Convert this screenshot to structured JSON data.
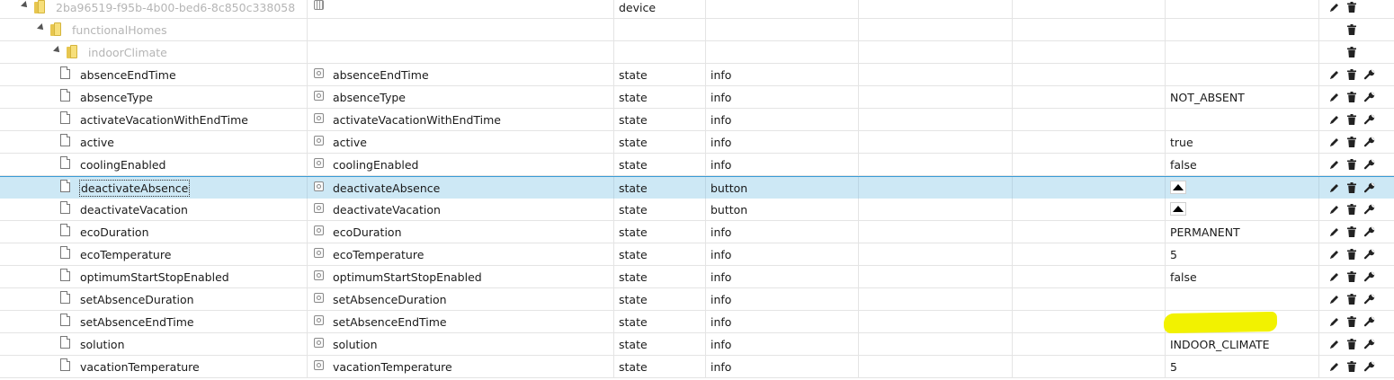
{
  "rows": [
    {
      "name": "2ba96519-f95b-4b00-bed6-8c850c338058",
      "level": 0,
      "kind": "folder",
      "faded": true,
      "expanded": true,
      "role_icon": "grid-icon",
      "role": "",
      "type": "device",
      "subrole": "",
      "value": "",
      "actions": [
        "edit",
        "delete"
      ]
    },
    {
      "name": "functionalHomes",
      "level": 1,
      "kind": "folder",
      "faded": true,
      "expanded": true,
      "role_icon": "",
      "role": "",
      "type": "",
      "subrole": "",
      "value": "",
      "actions": [
        "delete"
      ]
    },
    {
      "name": "indoorClimate",
      "level": 2,
      "kind": "folder",
      "faded": true,
      "expanded": true,
      "role_icon": "",
      "role": "",
      "type": "",
      "subrole": "",
      "value": "",
      "actions": [
        "delete"
      ]
    },
    {
      "name": "absenceEndTime",
      "level": 3,
      "kind": "file",
      "role_icon": "state-icon",
      "role": "absenceEndTime",
      "type": "state",
      "subrole": "info",
      "value": "",
      "actions": [
        "edit",
        "delete",
        "settings"
      ]
    },
    {
      "name": "absenceType",
      "level": 3,
      "kind": "file",
      "role_icon": "state-icon",
      "role": "absenceType",
      "type": "state",
      "subrole": "info",
      "value": "NOT_ABSENT",
      "actions": [
        "edit",
        "delete",
        "settings"
      ]
    },
    {
      "name": "activateVacationWithEndTime",
      "level": 3,
      "kind": "file",
      "role_icon": "state-icon",
      "role": "activateVacationWithEndTime",
      "type": "state",
      "subrole": "info",
      "value": "",
      "actions": [
        "edit",
        "delete",
        "settings"
      ]
    },
    {
      "name": "active",
      "level": 3,
      "kind": "file",
      "role_icon": "state-icon",
      "role": "active",
      "type": "state",
      "subrole": "info",
      "value": "true",
      "actions": [
        "edit",
        "delete",
        "settings"
      ]
    },
    {
      "name": "coolingEnabled",
      "level": 3,
      "kind": "file",
      "role_icon": "state-icon",
      "role": "coolingEnabled",
      "type": "state",
      "subrole": "info",
      "value": "false",
      "actions": [
        "edit",
        "delete",
        "settings"
      ]
    },
    {
      "name": "deactivateAbsence",
      "level": 3,
      "kind": "file",
      "selected": true,
      "role_icon": "state-icon",
      "role": "deactivateAbsence",
      "type": "state",
      "subrole": "button",
      "value": "",
      "value_button": true,
      "actions": [
        "edit",
        "delete",
        "settings"
      ]
    },
    {
      "name": "deactivateVacation",
      "level": 3,
      "kind": "file",
      "role_icon": "state-icon",
      "role": "deactivateVacation",
      "type": "state",
      "subrole": "button",
      "value": "",
      "value_button": true,
      "actions": [
        "edit",
        "delete",
        "settings"
      ]
    },
    {
      "name": "ecoDuration",
      "level": 3,
      "kind": "file",
      "role_icon": "state-icon",
      "role": "ecoDuration",
      "type": "state",
      "subrole": "info",
      "value": "PERMANENT",
      "actions": [
        "edit",
        "delete",
        "settings"
      ]
    },
    {
      "name": "ecoTemperature",
      "level": 3,
      "kind": "file",
      "role_icon": "state-icon",
      "role": "ecoTemperature",
      "type": "state",
      "subrole": "info",
      "value": "5",
      "actions": [
        "edit",
        "delete",
        "settings"
      ]
    },
    {
      "name": "optimumStartStopEnabled",
      "level": 3,
      "kind": "file",
      "role_icon": "state-icon",
      "role": "optimumStartStopEnabled",
      "type": "state",
      "subrole": "info",
      "value": "false",
      "actions": [
        "edit",
        "delete",
        "settings"
      ]
    },
    {
      "name": "setAbsenceDuration",
      "level": 3,
      "kind": "file",
      "role_icon": "state-icon",
      "role": "setAbsenceDuration",
      "type": "state",
      "subrole": "info",
      "value": "",
      "actions": [
        "edit",
        "delete",
        "settings"
      ]
    },
    {
      "name": "setAbsenceEndTime",
      "level": 3,
      "kind": "file",
      "role_icon": "state-icon",
      "role": "setAbsenceEndTime",
      "type": "state",
      "subrole": "info",
      "value": "",
      "highlighted": true,
      "actions": [
        "edit",
        "delete",
        "settings"
      ]
    },
    {
      "name": "solution",
      "level": 3,
      "kind": "file",
      "role_icon": "state-icon",
      "role": "solution",
      "type": "state",
      "subrole": "info",
      "value": "INDOOR_CLIMATE",
      "actions": [
        "edit",
        "delete",
        "settings"
      ]
    },
    {
      "name": "vacationTemperature",
      "level": 3,
      "kind": "file",
      "role_icon": "state-icon",
      "role": "vacationTemperature",
      "type": "state",
      "subrole": "info",
      "value": "5",
      "actions": [
        "edit",
        "delete",
        "settings"
      ]
    }
  ],
  "colors": {
    "selected_bg": "#cde8f5",
    "selected_border": "#3a9bd6",
    "highlight": "#f2f200",
    "folder": "#f7df7a"
  }
}
